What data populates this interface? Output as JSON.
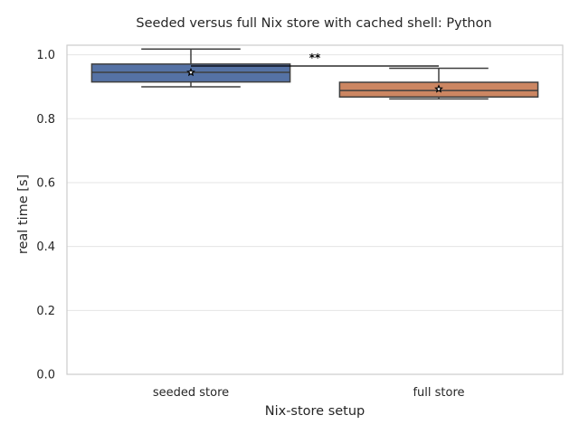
{
  "chart_data": {
    "type": "box",
    "title": "Seeded versus full Nix store with cached shell: Python",
    "xlabel": "Nix-store setup",
    "ylabel": "real time [s]",
    "ylim": [
      0.0,
      1.03
    ],
    "yticks": [
      0.0,
      0.2,
      0.4,
      0.6,
      0.8,
      1.0
    ],
    "ytick_labels": [
      "0.0",
      "0.2",
      "0.4",
      "0.6",
      "0.8",
      "1.0"
    ],
    "grid": true,
    "categories": [
      "seeded store",
      "full store"
    ],
    "boxes": [
      {
        "category": "seeded store",
        "whisker_low": 0.9,
        "q1": 0.915,
        "median": 0.945,
        "q3": 0.971,
        "whisker_high": 1.018,
        "mean": 0.945,
        "color": "#5572a5"
      },
      {
        "category": "full store",
        "whisker_low": 0.862,
        "q1": 0.868,
        "median": 0.888,
        "q3": 0.914,
        "whisker_high": 0.958,
        "mean": 0.893,
        "color": "#cc8662"
      }
    ],
    "significance": {
      "label": "**",
      "y": 0.965,
      "between": [
        0,
        1
      ]
    }
  }
}
